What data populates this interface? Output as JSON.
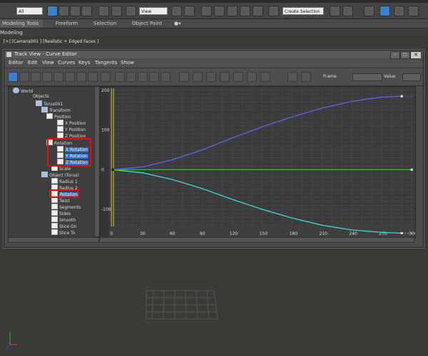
{
  "app": {
    "main_toolbar": {
      "selection_filter": "All",
      "view_dropdown": "View",
      "create_selection_set": "Create Selection Se"
    },
    "ribbon": {
      "tabs": [
        "Modeling",
        "Freeform",
        "Selection",
        "Object Paint"
      ]
    },
    "modeling_panel": "Modeling",
    "viewport_label": "[+] [Camera001 ] [Realistic + Edged Faces ]"
  },
  "track_view": {
    "title": "Track View - Curve Editor",
    "menu": [
      "Editor",
      "Edit",
      "View",
      "Curves",
      "Keys",
      "Tangents",
      "Show"
    ],
    "frame_label": "Frame",
    "value_label": "Value",
    "tree": [
      {
        "label": "World",
        "level": 0
      },
      {
        "label": "Objects",
        "level": 1
      },
      {
        "label": "Torus001",
        "level": 2
      },
      {
        "label": "Transform",
        "level": 3
      },
      {
        "label": "Position",
        "level": 4
      },
      {
        "label": "X Position",
        "level": 5
      },
      {
        "label": "Y Position",
        "level": 5
      },
      {
        "label": "Z Position",
        "level": 5
      },
      {
        "label": "Rotation",
        "level": 4
      },
      {
        "label": "X Rotation",
        "level": 5,
        "selected": true
      },
      {
        "label": "Y Rotation",
        "level": 5,
        "selected": true
      },
      {
        "label": "Z Rotation",
        "level": 5,
        "selected": true
      },
      {
        "label": "Scale",
        "level": 4
      },
      {
        "label": "Object (Torus)",
        "level": 3
      },
      {
        "label": "Radius 1",
        "level": 4
      },
      {
        "label": "Radius 2",
        "level": 4
      },
      {
        "label": "Rotation",
        "level": 4,
        "selected": true
      },
      {
        "label": "Twist",
        "level": 4
      },
      {
        "label": "Segments",
        "level": 4
      },
      {
        "label": "Sides",
        "level": 4
      },
      {
        "label": "Smooth",
        "level": 4
      },
      {
        "label": "Slice On",
        "level": 4
      },
      {
        "label": "Slice To",
        "level": 4
      }
    ]
  },
  "chart_data": {
    "type": "line",
    "x_ticks": [
      0,
      30,
      60,
      90,
      120,
      150,
      180,
      210,
      240,
      270,
      300
    ],
    "y_ticks": [
      200,
      100,
      0,
      -100
    ],
    "xlim": [
      -3,
      302
    ],
    "ylim": [
      -143,
      205
    ],
    "series": [
      {
        "color": "#5a63f0",
        "x": [
          0,
          30,
          60,
          90,
          120,
          150,
          180,
          210,
          240,
          270,
          290
        ],
        "y": [
          0,
          7,
          25,
          50,
          80,
          108,
          133,
          155,
          172,
          183,
          185
        ]
      },
      {
        "color": "#3fd6d6",
        "x": [
          0,
          30,
          60,
          90,
          120,
          150,
          180,
          210,
          240,
          270,
          290
        ],
        "y": [
          0,
          -8,
          -25,
          -48,
          -75,
          -100,
          -122,
          -140,
          -152,
          -158,
          -160
        ]
      },
      {
        "color": "#34b234",
        "x": [
          0,
          300
        ],
        "y": [
          0,
          0
        ]
      }
    ],
    "time_slider_frame": 0,
    "grid": true
  }
}
